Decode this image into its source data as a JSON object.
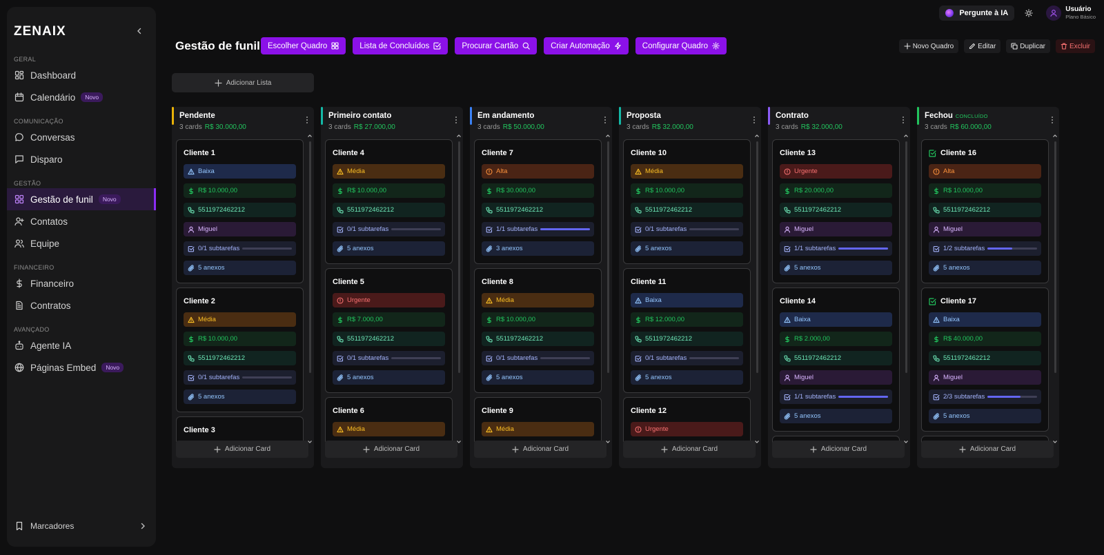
{
  "sidebar": {
    "logo": "ZENAIX",
    "sections": [
      {
        "title": "GERAL",
        "items": [
          {
            "label": "Dashboard",
            "icon": "dashboard-icon",
            "badge": ""
          },
          {
            "label": "Calendário",
            "icon": "calendar-icon",
            "badge": "Novo"
          }
        ]
      },
      {
        "title": "COMUNICAÇÃO",
        "items": [
          {
            "label": "Conversas",
            "icon": "chat-icon",
            "badge": ""
          },
          {
            "label": "Disparo",
            "icon": "message-icon",
            "badge": ""
          }
        ]
      },
      {
        "title": "GESTÃO",
        "items": [
          {
            "label": "Gestão de funil",
            "icon": "funnel-icon",
            "badge": "Novo",
            "active": true
          },
          {
            "label": "Contatos",
            "icon": "user-plus-icon",
            "badge": ""
          },
          {
            "label": "Equipe",
            "icon": "users-icon",
            "badge": ""
          }
        ]
      },
      {
        "title": "FINANCEIRO",
        "items": [
          {
            "label": "Financeiro",
            "icon": "dollar-icon",
            "badge": ""
          },
          {
            "label": "Contratos",
            "icon": "document-icon",
            "badge": ""
          }
        ]
      },
      {
        "title": "AVANÇADO",
        "items": [
          {
            "label": "Agente IA",
            "icon": "bot-icon",
            "badge": ""
          },
          {
            "label": "Páginas Embed",
            "icon": "globe-icon",
            "badge": "Novo"
          }
        ]
      }
    ],
    "bookmarks_label": "Marcadores"
  },
  "topbar": {
    "ask_ia": "Pergunte à IA",
    "user_name": "Usuário",
    "user_plan": "Plano Básico"
  },
  "page": {
    "title": "Gestão de funil",
    "toolbar": [
      {
        "label": "Escolher Quadro",
        "icon": "grid-icon",
        "name": "escolher-quadro-button"
      },
      {
        "label": "Lista de Concluídos",
        "icon": "check-square-icon",
        "name": "lista-concluidos-button"
      },
      {
        "label": "Procurar Cartão",
        "icon": "search-icon",
        "name": "procurar-cartao-button"
      },
      {
        "label": "Criar Automação",
        "icon": "zap-icon",
        "name": "criar-automacao-button"
      },
      {
        "label": "Configurar Quadro",
        "icon": "gear-icon",
        "name": "configurar-quadro-button"
      }
    ],
    "actions": [
      {
        "label": "Novo Quadro",
        "icon": "plus-icon",
        "name": "novo-quadro-button"
      },
      {
        "label": "Editar",
        "icon": "pencil-icon",
        "name": "editar-button"
      },
      {
        "label": "Duplicar",
        "icon": "copy-icon",
        "name": "duplicar-button"
      },
      {
        "label": "Excluir",
        "icon": "trash-icon",
        "name": "excluir-button",
        "danger": true
      }
    ],
    "add_list_label": "Adicionar Lista",
    "add_card_label": "Adicionar Card"
  },
  "columns": [
    {
      "title": "Pendente",
      "tag": "",
      "count": "3 cards",
      "total": "R$ 30.000,00",
      "color": "#eab308",
      "cards": [
        {
          "title": "Cliente 1",
          "done": false,
          "priority": {
            "label": "Baixa",
            "level": "baixa"
          },
          "value": "R$ 10.000,00",
          "phone": "5511972462212",
          "user": "Miguel",
          "subtasks": "0/1 subtarefas",
          "progress": 0,
          "attachments": "5 anexos"
        },
        {
          "title": "Cliente 2",
          "done": false,
          "priority": {
            "label": "Média",
            "level": "media"
          },
          "value": "R$ 10.000,00",
          "phone": "5511972462212",
          "user": "",
          "subtasks": "0/1 subtarefas",
          "progress": 0,
          "attachments": "5 anexos"
        },
        {
          "title": "Cliente 3",
          "done": false,
          "priority": {
            "label": "",
            "level": ""
          },
          "value": "",
          "phone": "",
          "user": "",
          "subtasks": "",
          "progress": 0,
          "attachments": ""
        }
      ]
    },
    {
      "title": "Primeiro contato",
      "tag": "",
      "count": "3 cards",
      "total": "R$ 27.000,00",
      "color": "#14b8a6",
      "cards": [
        {
          "title": "Cliente 4",
          "done": false,
          "priority": {
            "label": "Média",
            "level": "media"
          },
          "value": "R$ 10.000,00",
          "phone": "5511972462212",
          "user": "",
          "subtasks": "0/1 subtarefas",
          "progress": 0,
          "attachments": "5 anexos"
        },
        {
          "title": "Cliente 5",
          "done": false,
          "priority": {
            "label": "Urgente",
            "level": "urgente"
          },
          "value": "R$ 7.000,00",
          "phone": "5511972462212",
          "user": "",
          "subtasks": "0/1 subtarefas",
          "progress": 0,
          "attachments": "5 anexos"
        },
        {
          "title": "Cliente 6",
          "done": false,
          "priority": {
            "label": "Média",
            "level": "media"
          },
          "value": "",
          "phone": "",
          "user": "",
          "subtasks": "",
          "progress": 0,
          "attachments": ""
        }
      ]
    },
    {
      "title": "Em andamento",
      "tag": "",
      "count": "3 cards",
      "total": "R$ 50.000,00",
      "color": "#3b82f6",
      "cards": [
        {
          "title": "Cliente 7",
          "done": false,
          "priority": {
            "label": "Alta",
            "level": "alta"
          },
          "value": "R$ 30.000,00",
          "phone": "5511972462212",
          "user": "",
          "subtasks": "1/1 subtarefas",
          "progress": 1,
          "attachments": "3 anexos"
        },
        {
          "title": "Cliente 8",
          "done": false,
          "priority": {
            "label": "Média",
            "level": "media"
          },
          "value": "R$ 10.000,00",
          "phone": "5511972462212",
          "user": "",
          "subtasks": "0/1 subtarefas",
          "progress": 0,
          "attachments": "5 anexos"
        },
        {
          "title": "Cliente 9",
          "done": false,
          "priority": {
            "label": "Média",
            "level": "media"
          },
          "value": "",
          "phone": "",
          "user": "",
          "subtasks": "",
          "progress": 0,
          "attachments": ""
        }
      ]
    },
    {
      "title": "Proposta",
      "tag": "",
      "count": "3 cards",
      "total": "R$ 32.000,00",
      "color": "#14b8a6",
      "cards": [
        {
          "title": "Cliente 10",
          "done": false,
          "priority": {
            "label": "Média",
            "level": "media"
          },
          "value": "R$ 10.000,00",
          "phone": "5511972462212",
          "user": "",
          "subtasks": "0/1 subtarefas",
          "progress": 0,
          "attachments": "5 anexos"
        },
        {
          "title": "Cliente 11",
          "done": false,
          "priority": {
            "label": "Baixa",
            "level": "baixa"
          },
          "value": "R$ 12.000,00",
          "phone": "5511972462212",
          "user": "",
          "subtasks": "0/1 subtarefas",
          "progress": 0,
          "attachments": "5 anexos"
        },
        {
          "title": "Cliente 12",
          "done": false,
          "priority": {
            "label": "Urgente",
            "level": "urgente"
          },
          "value": "",
          "phone": "",
          "user": "",
          "subtasks": "",
          "progress": 0,
          "attachments": ""
        }
      ]
    },
    {
      "title": "Contrato",
      "tag": "",
      "count": "3 cards",
      "total": "R$ 32.000,00",
      "color": "#8b5cf6",
      "cards": [
        {
          "title": "Cliente 13",
          "done": false,
          "priority": {
            "label": "Urgente",
            "level": "urgente"
          },
          "value": "R$ 20.000,00",
          "phone": "5511972462212",
          "user": "Miguel",
          "subtasks": "1/1 subtarefas",
          "progress": 1,
          "attachments": "5 anexos"
        },
        {
          "title": "Cliente 14",
          "done": false,
          "priority": {
            "label": "Baixa",
            "level": "baixa"
          },
          "value": "R$ 2.000,00",
          "phone": "5511972462212",
          "user": "Miguel",
          "subtasks": "1/1 subtarefas",
          "progress": 1,
          "attachments": "5 anexos"
        },
        {
          "title": "",
          "done": false,
          "priority": {
            "label": "",
            "level": ""
          },
          "value": "",
          "phone": "",
          "user": "",
          "subtasks": "",
          "progress": 0,
          "attachments": ""
        }
      ]
    },
    {
      "title": "Fechou",
      "tag": "CONCLUÍDO",
      "count": "3 cards",
      "total": "R$ 60.000,00",
      "color": "#22c55e",
      "cards": [
        {
          "title": "Cliente 16",
          "done": true,
          "priority": {
            "label": "Alta",
            "level": "alta"
          },
          "value": "R$ 10.000,00",
          "phone": "5511972462212",
          "user": "Miguel",
          "subtasks": "1/2 subtarefas",
          "progress": 0.5,
          "attachments": "5 anexos"
        },
        {
          "title": "Cliente 17",
          "done": true,
          "priority": {
            "label": "Baixa",
            "level": "baixa"
          },
          "value": "R$ 40.000,00",
          "phone": "5511972462212",
          "user": "Miguel",
          "subtasks": "2/3 subtarefas",
          "progress": 0.67,
          "attachments": "5 anexos"
        },
        {
          "title": "",
          "done": false,
          "priority": {
            "label": "",
            "level": ""
          },
          "value": "",
          "phone": "",
          "user": "",
          "subtasks": "",
          "progress": 0,
          "attachments": ""
        }
      ]
    }
  ]
}
